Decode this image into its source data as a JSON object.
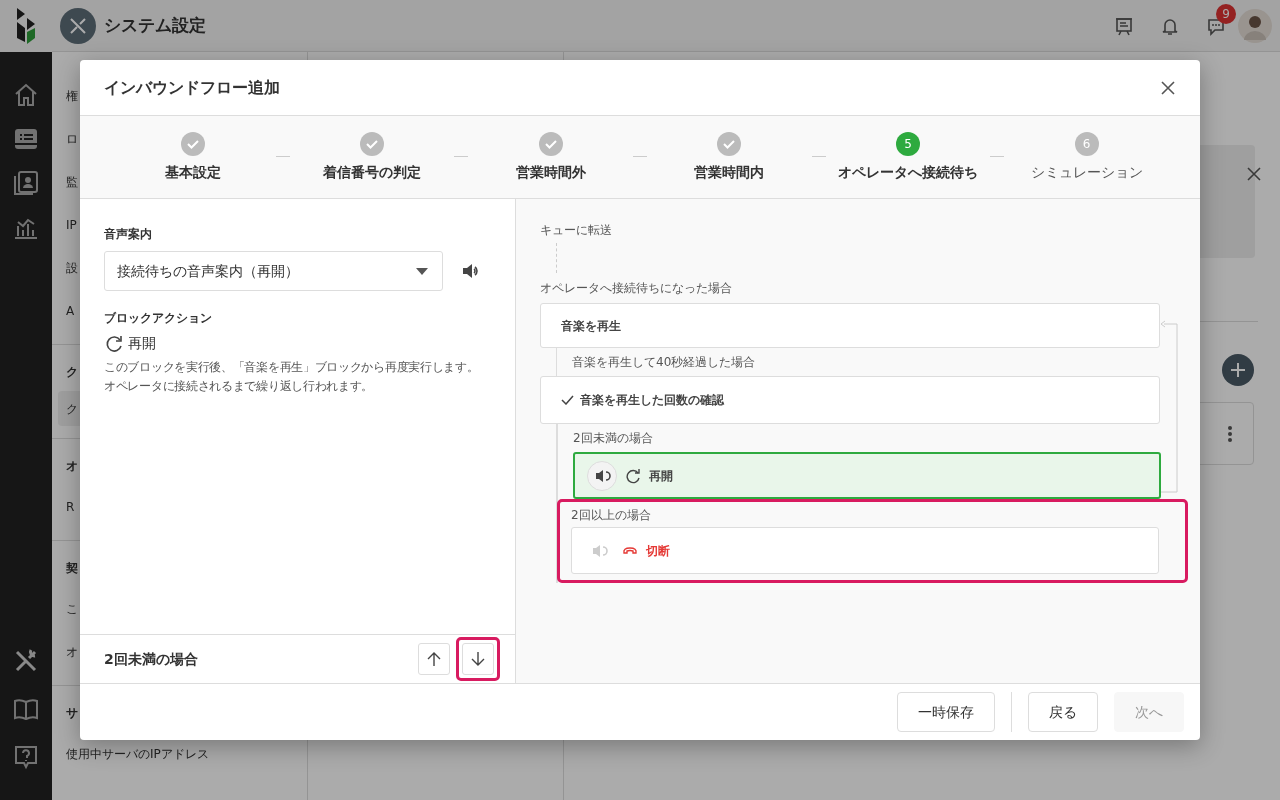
{
  "app": {
    "title": "システム設定",
    "notification_count": "9"
  },
  "background_nav": [
    {
      "kind": "item",
      "text": "権"
    },
    {
      "kind": "item",
      "text": "ロ"
    },
    {
      "kind": "item",
      "text": "監"
    },
    {
      "kind": "item",
      "text": "IP"
    },
    {
      "kind": "item",
      "text": "設"
    },
    {
      "kind": "item",
      "text": "A"
    },
    {
      "kind": "header",
      "text": "ク"
    },
    {
      "kind": "selected",
      "text": "ク"
    },
    {
      "kind": "header",
      "text": "オ"
    },
    {
      "kind": "item",
      "text": "R"
    },
    {
      "kind": "header",
      "text": "契"
    },
    {
      "kind": "item",
      "text": "こ"
    },
    {
      "kind": "item",
      "text": "オ"
    },
    {
      "kind": "header",
      "text": "サ"
    },
    {
      "kind": "item",
      "text": "使用中サーバのIPアドレス"
    }
  ],
  "dialog": {
    "title": "インバウンドフロー追加",
    "steps": [
      {
        "label": "基本設定",
        "done": true,
        "selected": false
      },
      {
        "label": "着信番号の判定",
        "done": true,
        "selected": false
      },
      {
        "label": "営業時間外",
        "done": true,
        "selected": false
      },
      {
        "label": "営業時間内",
        "done": true,
        "selected": false
      },
      {
        "label": "オペレータへ接続待ち",
        "done": false,
        "selected": true,
        "number": "5"
      },
      {
        "label": "シミュレーション",
        "done": false,
        "selected": false,
        "number": "6"
      }
    ],
    "settings": {
      "voice_label": "音声案内",
      "voice_value": "接続待ちの音声案内（再開）",
      "action_label": "ブロックアクション",
      "action": "再開",
      "description": [
        "このブロックを実行後、「音楽を再生」ブロックから再度実行します。",
        "オペレータに接続されるまで繰り返し行われます。"
      ]
    },
    "branch_bar": {
      "title": "2回未満の場合",
      "buttons": [
        {
          "kind": "up",
          "highlighted": false
        },
        {
          "kind": "down",
          "highlighted": true
        }
      ]
    },
    "flow": {
      "start": "キューに転送",
      "trigger": "オペレータへ接続待ちになった場合",
      "play": {
        "label": "音楽を再生",
        "condition": "音楽を再生して40秒経過した場合"
      },
      "check": {
        "label": "音楽を再生した回数の確認"
      },
      "branches": [
        {
          "condition": "2回未満の場合",
          "kind": "restart",
          "label": "再開",
          "selected": true,
          "highlighted": false,
          "sound": true
        },
        {
          "condition": "2回以上の場合",
          "kind": "hangup",
          "label": "切断",
          "selected": false,
          "highlighted": true,
          "sound": false
        }
      ]
    },
    "footer": [
      {
        "label": "一時保存",
        "disabled": false
      },
      {
        "label": "戻る",
        "disabled": false
      },
      {
        "label": "次へ",
        "disabled": true
      }
    ]
  }
}
